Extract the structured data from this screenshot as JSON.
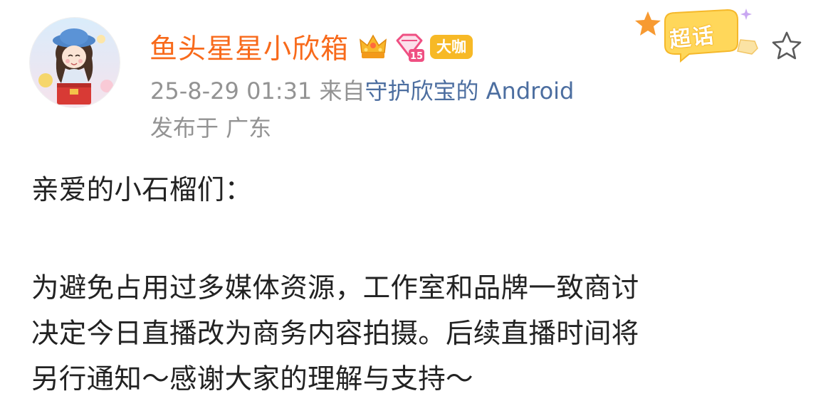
{
  "post": {
    "author": {
      "name": "鱼头星星小欣箱",
      "badge_label": "大咖",
      "level": "15"
    },
    "meta": {
      "datetime": "25-8-29 01:31",
      "source_prefix": "来自",
      "source_name": "守护欣宝的 Android",
      "location": "发布于 广东"
    },
    "super_topic_label": "超话",
    "content": {
      "greeting": "亲爱的小石榴们：",
      "lines": [
        "为避免占用过多媒体资源，工作室和品牌一致商讨",
        "决定今日直播改为商务内容拍摄。后续直播时间将",
        "另行通知～感谢大家的理解与支持～"
      ]
    }
  },
  "icons": {
    "avatar": "avatar-image",
    "crown": "crown-icon",
    "level": "diamond-level-icon",
    "super_topic": "super-topic-sticker",
    "star": "star-icon"
  },
  "colors": {
    "username": "#f86a1b",
    "meta_text": "#939393",
    "source_link": "#4c6ea0",
    "body_text": "#222222",
    "daka_badge": "#f7b926",
    "level_badge": "#ef4f82"
  }
}
